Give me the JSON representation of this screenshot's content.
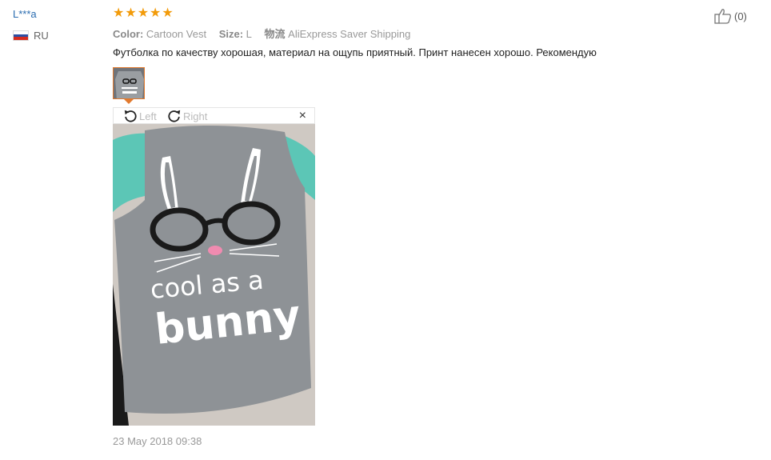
{
  "review": {
    "user_name": "L***a",
    "country_code": "RU",
    "rating": 5,
    "color_label": "Color:",
    "color_value": "Cartoon Vest",
    "size_label": "Size:",
    "size_value": "L",
    "shipping_label": "物流",
    "shipping_value": "AliExpress Saver Shipping",
    "text": "Футболка по качеству хорошая, материал на ощупь приятный. Принт нанесен хорошо. Рекомендую",
    "date": "23 May 2018 09:38",
    "helpful_count": "(0)"
  },
  "viewer": {
    "rotate_left": "Left",
    "rotate_right": "Right",
    "close": "×"
  },
  "photo": {
    "print_line1": "cool as a",
    "print_line2": "bunny"
  },
  "colors": {
    "star": "#f29b0a",
    "link": "#2a6cb0",
    "thumb_border": "#e27a2e",
    "shirt_gray": "#8e9296",
    "sleeve_teal": "#5cc6b6"
  }
}
